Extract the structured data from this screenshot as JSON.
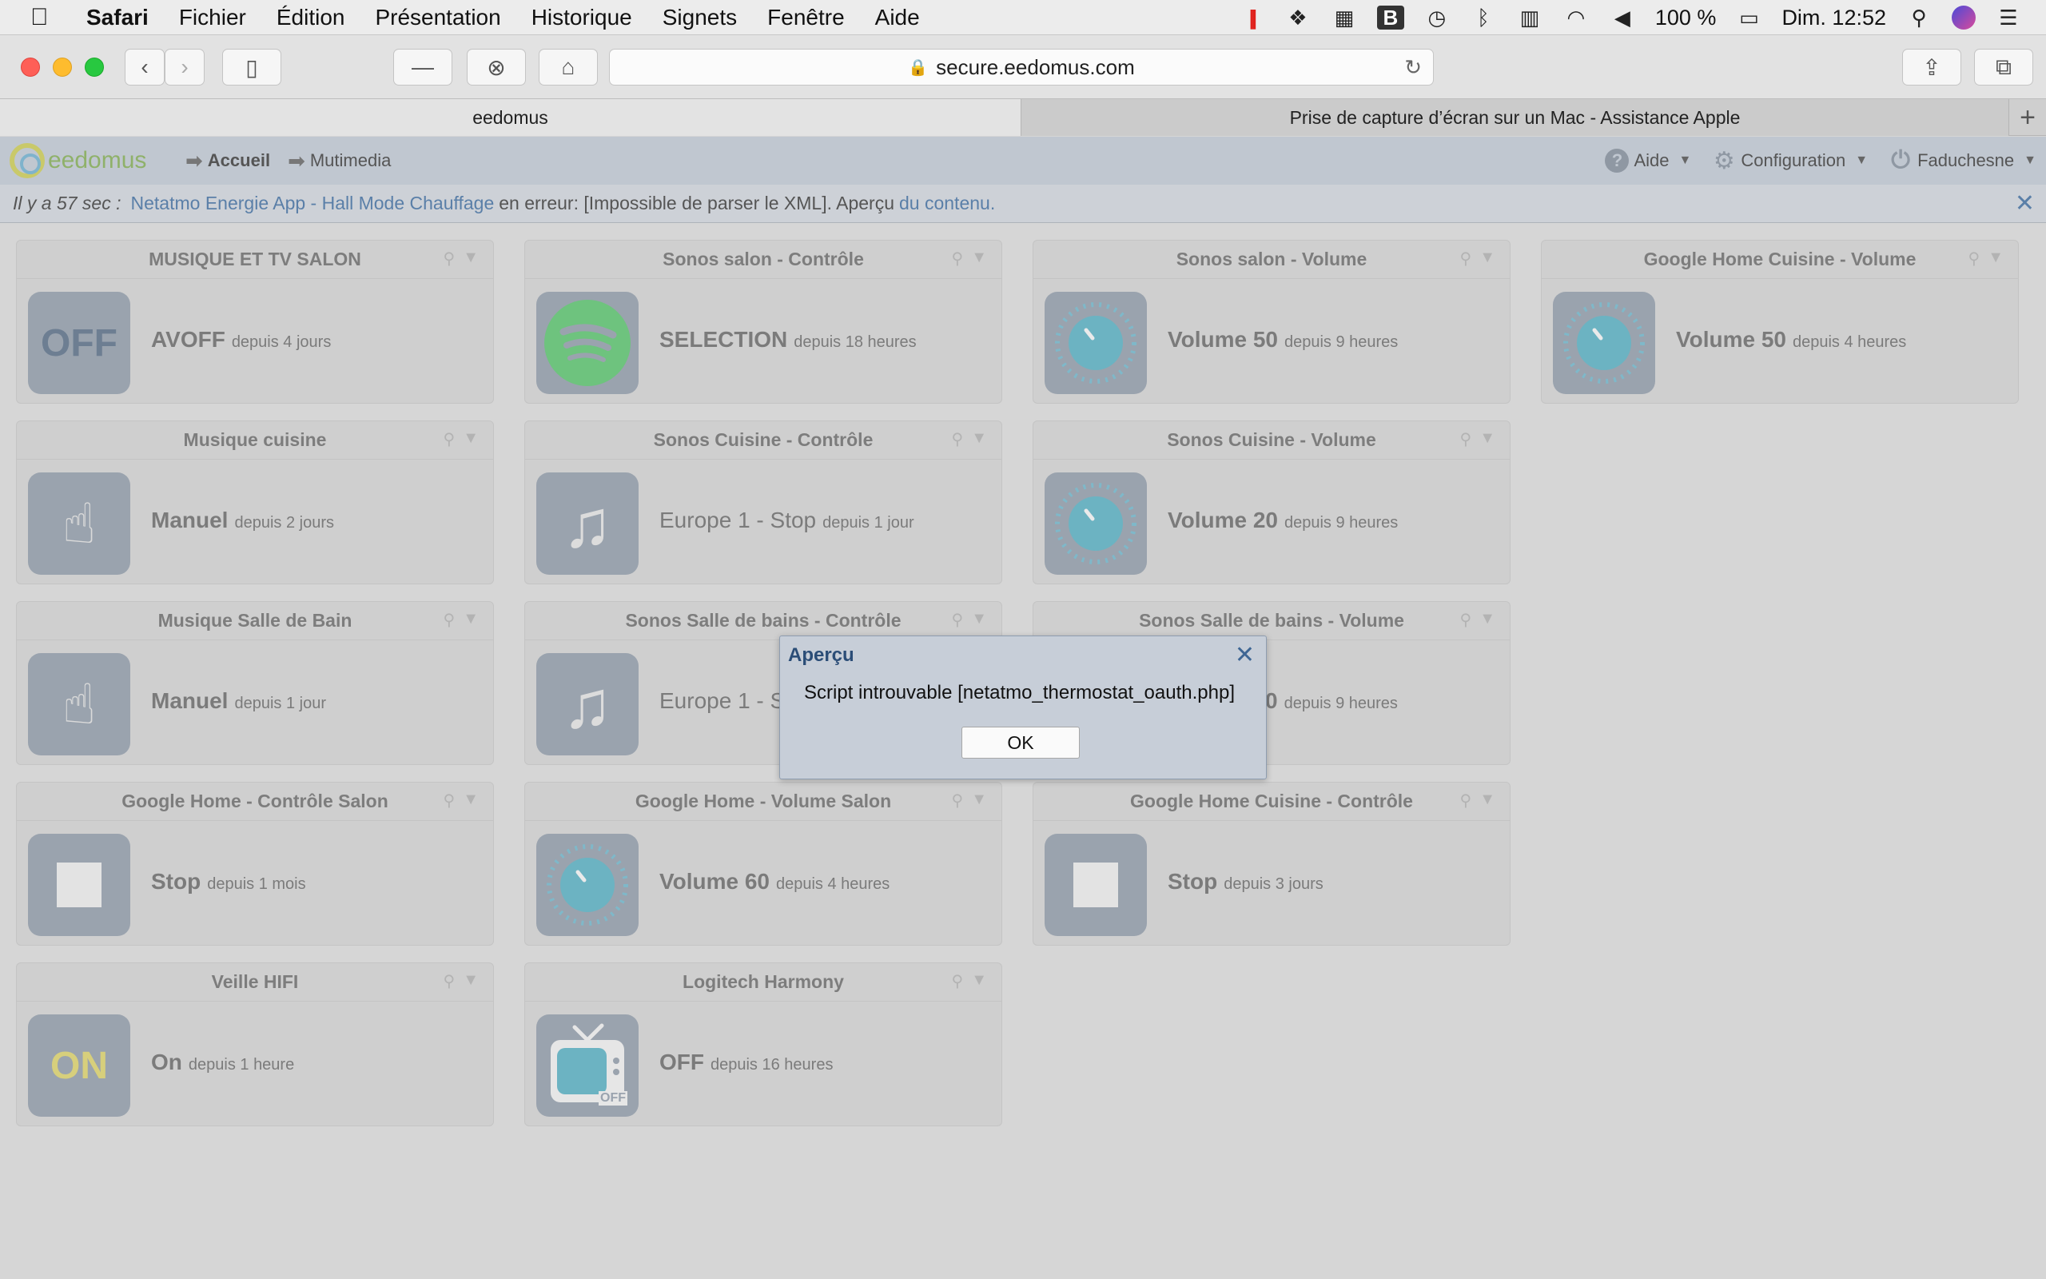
{
  "menubar": {
    "app": "Safari",
    "items": [
      "Fichier",
      "Édition",
      "Présentation",
      "Historique",
      "Signets",
      "Fenêtre",
      "Aide"
    ],
    "battery": "100 %",
    "clock": "Dim. 12:52"
  },
  "browser": {
    "url": "secure.eedomus.com",
    "tabs": [
      {
        "title": "eedomus"
      },
      {
        "title": "Prise de capture d’écran sur un Mac - Assistance Apple"
      }
    ]
  },
  "app": {
    "logo": "eedomus",
    "nav": [
      "Accueil",
      "Mutimedia"
    ],
    "help": "Aide",
    "config": "Configuration",
    "user": "Faduchesne"
  },
  "alert": {
    "prefix": "Il y a 57 sec :",
    "link": "Netatmo Energie App - Hall Mode Chauffage",
    "middle": "en erreur: [Impossible de parser le XML]. Aperçu",
    "link2": "du contenu."
  },
  "tiles": [
    {
      "title": "MUSIQUE ET TV SALON",
      "icon_text": "OFF",
      "state": "AVOFF",
      "since": "depuis 4 jours"
    },
    {
      "title": "Sonos salon - Contrôle",
      "state": "SELECTION",
      "since": "depuis 18 heures"
    },
    {
      "title": "Sonos salon - Volume",
      "state": "Volume 50",
      "since": "depuis 9 heures"
    },
    {
      "title": "Google Home Cuisine - Volume",
      "state": "Volume 50",
      "since": "depuis 4 heures"
    },
    {
      "title": "Musique cuisine",
      "state": "Manuel",
      "since": "depuis 2 jours"
    },
    {
      "title": "Sonos Cuisine - Contrôle",
      "state": "Europe 1 - Stop",
      "since": "depuis 1 jour"
    },
    {
      "title": "Sonos Cuisine - Volume",
      "state": "Volume 20",
      "since": "depuis 9 heures"
    },
    {
      "title": "Musique Salle de Bain",
      "state": "Manuel",
      "since": "depuis 1 jour"
    },
    {
      "title": "Sonos Salle de bains - Contrôle",
      "state": "Europe 1 - St",
      "since": ""
    },
    {
      "title": "Sonos Salle de bains - Volume",
      "state": "0",
      "since": "depuis 9 heures"
    },
    {
      "title": "Google Home - Contrôle Salon",
      "state": "Stop",
      "since": "depuis 1 mois"
    },
    {
      "title": "Google Home - Volume Salon",
      "state": "Volume 60",
      "since": "depuis 4 heures"
    },
    {
      "title": "Google Home Cuisine - Contrôle",
      "state": "Stop",
      "since": "depuis 3 jours"
    },
    {
      "title": "Veille HIFI",
      "icon_text": "ON",
      "state": "On",
      "since": "depuis 1 heure"
    },
    {
      "title": "Logitech Harmony",
      "icon_text": "OFF",
      "state": "OFF",
      "since": "depuis 16 heures"
    }
  ],
  "modal": {
    "title": "Aperçu",
    "message": "Script introuvable [netatmo_thermostat_oauth.php]",
    "ok": "OK"
  }
}
